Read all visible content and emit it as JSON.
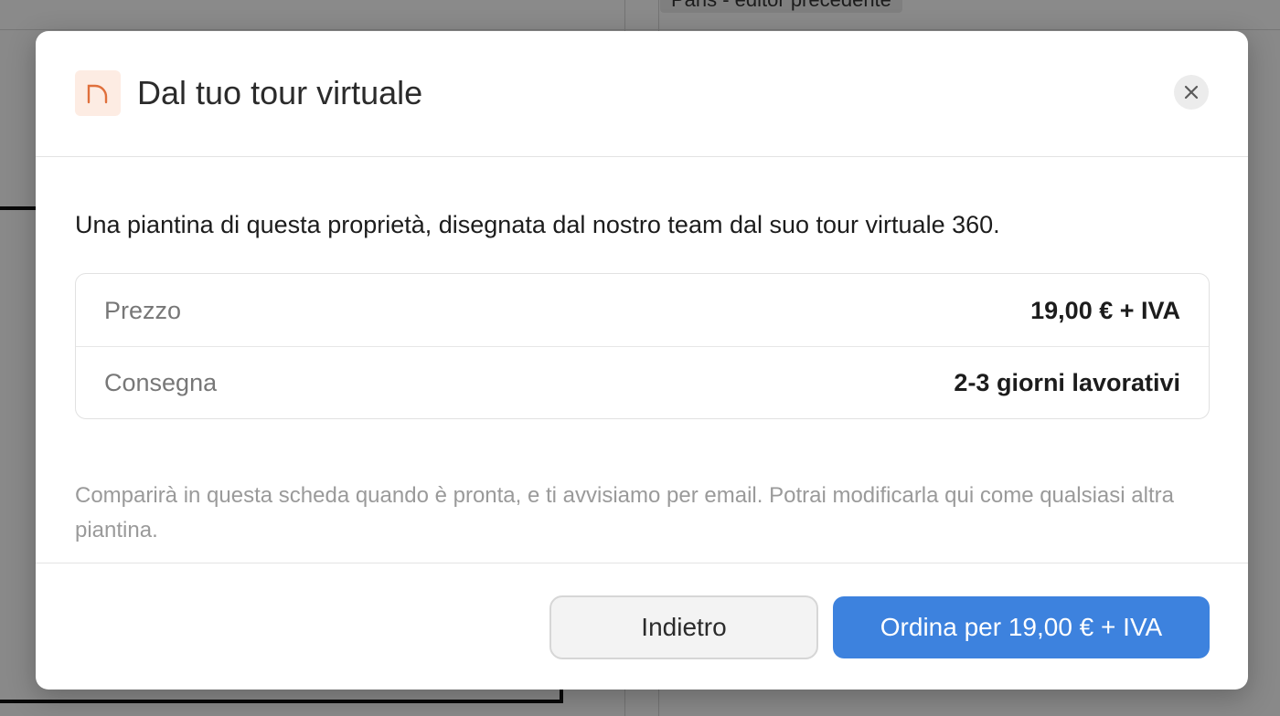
{
  "background": {
    "chip_text": "Paris - editor precedente"
  },
  "modal": {
    "title": "Dal tuo tour virtuale",
    "icon": "floorplan-arch-icon",
    "close_icon": "close-icon",
    "lead": "Una piantina di questa proprietà, disegnata dal nostro team dal suo tour virtuale 360.",
    "details": [
      {
        "label": "Prezzo",
        "value": "19,00 € + IVA"
      },
      {
        "label": "Consegna",
        "value": "2-3 giorni lavorativi"
      }
    ],
    "note": "Comparirà in questa scheda quando è pronta, e ti avvisiamo per email. Potrai modificarla qui come qualsiasi altra piantina.",
    "buttons": {
      "back": "Indietro",
      "order": "Ordina per 19,00 € + IVA"
    }
  },
  "colors": {
    "accent": "#3d82de",
    "icon_accent": "#e0703c",
    "icon_bg": "#fdece3"
  }
}
